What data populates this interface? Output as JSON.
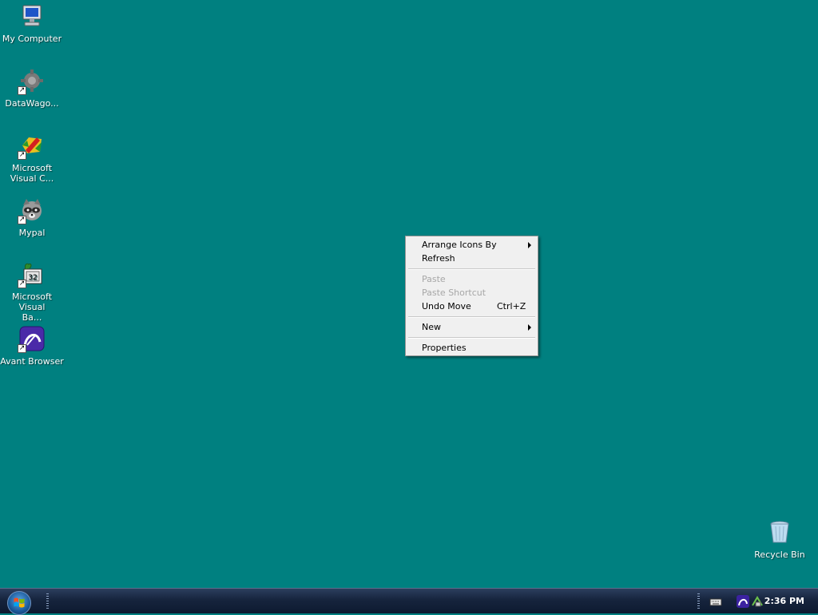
{
  "desktop": {
    "background": "#008080",
    "icons": [
      {
        "label": "My Computer",
        "icon": "my-computer-icon",
        "shortcut": false
      },
      {
        "label": "DataWago...",
        "icon": "datawagon-icon",
        "shortcut": true
      },
      {
        "label": "Microsoft Visual C...",
        "icon": "visual-c-icon",
        "shortcut": true
      },
      {
        "label": "Mypal",
        "icon": "mypal-raccoon-icon",
        "shortcut": true
      },
      {
        "label": "Microsoft Visual Ba...",
        "icon": "visual-basic-icon",
        "shortcut": true
      },
      {
        "label": "Avant Browser",
        "icon": "avant-browser-icon",
        "shortcut": true
      },
      {
        "label": "Recycle Bin",
        "icon": "recycle-bin-icon",
        "shortcut": false
      }
    ]
  },
  "context_menu": {
    "items": [
      {
        "label": "Arrange Icons By",
        "shortcut": "",
        "submenu": true,
        "enabled": true
      },
      {
        "label": "Refresh",
        "shortcut": "",
        "submenu": false,
        "enabled": true
      },
      {
        "label": "Paste",
        "shortcut": "",
        "submenu": false,
        "enabled": false
      },
      {
        "label": "Paste Shortcut",
        "shortcut": "",
        "submenu": false,
        "enabled": false
      },
      {
        "label": "Undo Move",
        "shortcut": "Ctrl+Z",
        "submenu": false,
        "enabled": true
      },
      {
        "label": "New",
        "shortcut": "",
        "submenu": true,
        "enabled": true
      },
      {
        "label": "Properties",
        "shortcut": "",
        "submenu": false,
        "enabled": true
      }
    ]
  },
  "taskbar": {
    "start_icon": "windows-start-orb-icon",
    "tray_icons": [
      "keyboard-icon",
      "avant-browser-icon",
      "network-icon"
    ],
    "clock": "2:36 PM"
  }
}
